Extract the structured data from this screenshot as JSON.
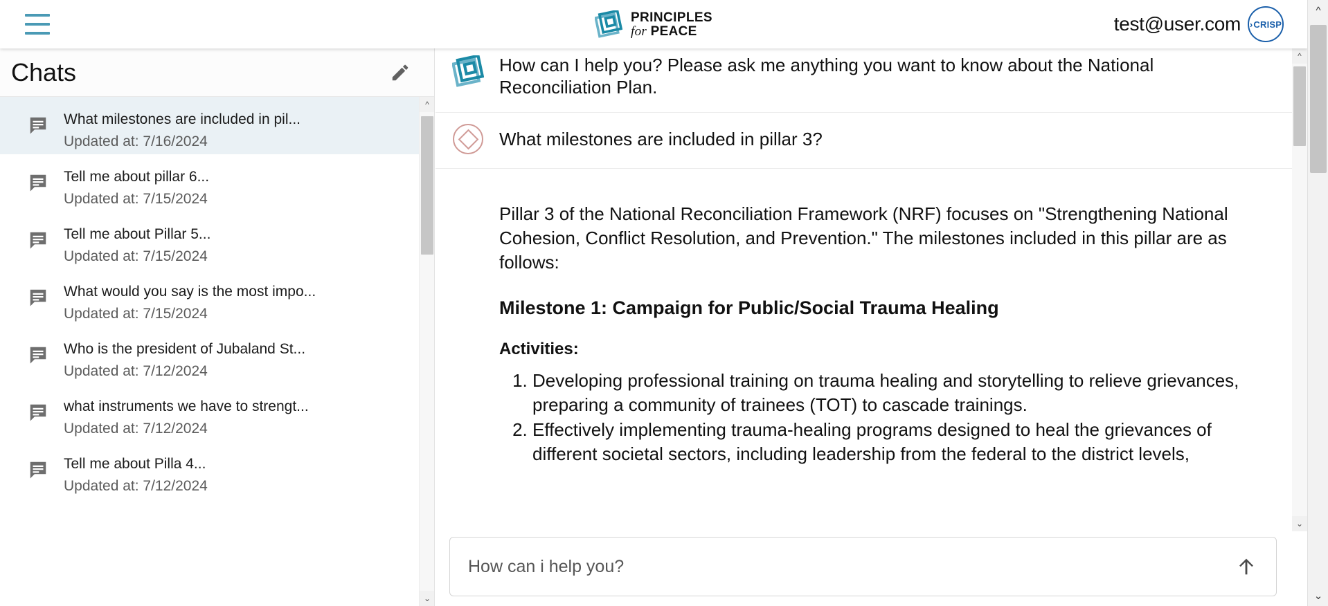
{
  "topbar": {
    "menu_icon": "hamburger-menu-icon",
    "brand": {
      "logo_icon": "principles-for-peace-logo-icon",
      "line1": "PRINCIPLES",
      "line2_italic": "for",
      "line2_bold": "PEACE"
    },
    "user_email": "test@user.com",
    "badge_label": "CRISP",
    "badge_chevron": "›"
  },
  "sidebar": {
    "title": "Chats",
    "edit_icon": "pencil-edit-icon",
    "scroll_up_icon": "chevron-up-icon",
    "scroll_down_icon": "chevron-down-icon",
    "items": [
      {
        "title": "What milestones are included in pil...",
        "updated": "Updated at: 7/16/2024",
        "selected": true
      },
      {
        "title": "Tell me about pillar 6...",
        "updated": "Updated at: 7/15/2024",
        "selected": false
      },
      {
        "title": "Tell me about Pillar 5...",
        "updated": "Updated at: 7/15/2024",
        "selected": false
      },
      {
        "title": "What would you say is the most impo...",
        "updated": "Updated at: 7/15/2024",
        "selected": false
      },
      {
        "title": "Who is the president of Jubaland St...",
        "updated": "Updated at: 7/12/2024",
        "selected": false
      },
      {
        "title": "what instruments we have to strengt...",
        "updated": "Updated at: 7/12/2024",
        "selected": false
      },
      {
        "title": "Tell me about Pilla 4...",
        "updated": "Updated at: 7/12/2024",
        "selected": false
      }
    ]
  },
  "conversation": {
    "intro": {
      "avatar_icon": "assistant-logo-avatar-icon",
      "text": "How can I help you? Please ask me anything you want to know about the National Reconciliation Plan."
    },
    "question": {
      "avatar_icon": "user-diamond-avatar-icon",
      "text": "What milestones are included in pillar 3?"
    },
    "answer": {
      "paragraph": "Pillar 3 of the National Reconciliation Framework (NRF) focuses on \"Strengthening National Cohesion, Conflict Resolution, and Prevention.\" The milestones included in this pillar are as follows:",
      "milestone_heading": "Milestone 1: Campaign for Public/Social Trauma Healing",
      "activities_label": "Activities:",
      "activities": [
        "Developing professional training on trauma healing and storytelling to relieve grievances, preparing a community of trainees (TOT) to cascade trainings.",
        "Effectively implementing trauma-healing programs designed to heal the grievances of different societal sectors, including leadership from the federal to the district levels,"
      ]
    }
  },
  "composer": {
    "placeholder": "How can i help you?",
    "value": "",
    "send_icon": "arrow-up-send-icon"
  },
  "colors": {
    "brand_teal": "#1b8aa6",
    "menu_blue": "#4a9ab5",
    "badge_blue": "#1a5faa",
    "user_avatar_rose": "#d09a96",
    "selected_row": "#eaf1f5"
  }
}
